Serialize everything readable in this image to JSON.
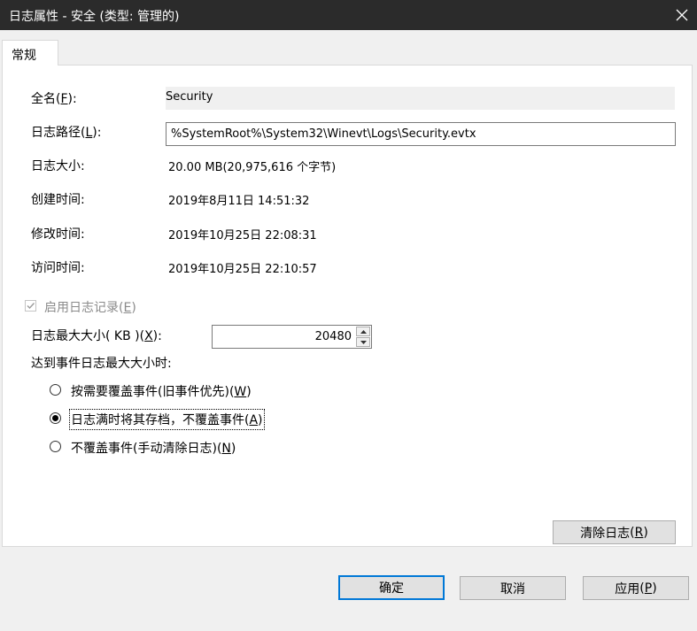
{
  "window": {
    "title": "日志属性 - 安全 (类型: 管理的)",
    "close_icon": "close-icon"
  },
  "tabs": [
    {
      "label": "常规",
      "selected": true
    }
  ],
  "general": {
    "full_name": {
      "label": "全名",
      "accel": "F",
      "value": "Security"
    },
    "log_path": {
      "label": "日志路径",
      "accel": "L",
      "value": "%SystemRoot%\\System32\\Winevt\\Logs\\Security.evtx"
    },
    "log_size": {
      "label": "日志大小:",
      "value": "20.00 MB(20,975,616 个字节)"
    },
    "created": {
      "label": "创建时间:",
      "value": "2019年8月11日 14:51:32"
    },
    "modified": {
      "label": "修改时间:",
      "value": "2019年10月25日 22:08:31"
    },
    "accessed": {
      "label": "访问时间:",
      "value": "2019年10月25日 22:10:57"
    }
  },
  "enable_logging": {
    "label": "启用日志记录",
    "accel": "E",
    "checked": true,
    "disabled": true
  },
  "max_size": {
    "label": "日志最大大小( KB )",
    "accel": "X",
    "value": "20480"
  },
  "when_max": {
    "label": "达到事件日志最大大小时:",
    "options": [
      {
        "label": "按需要覆盖事件(旧事件优先)",
        "accel": "W",
        "selected": false
      },
      {
        "label": "日志满时将其存档，不覆盖事件",
        "accel": "A",
        "selected": true
      },
      {
        "label": "不覆盖事件(手动清除日志)",
        "accel": "N",
        "selected": false
      }
    ]
  },
  "buttons": {
    "clear_log": {
      "label": "清除日志",
      "accel": "R"
    },
    "ok": {
      "label": "确定"
    },
    "cancel": {
      "label": "取消"
    },
    "apply": {
      "label": "应用",
      "accel": "P"
    }
  }
}
